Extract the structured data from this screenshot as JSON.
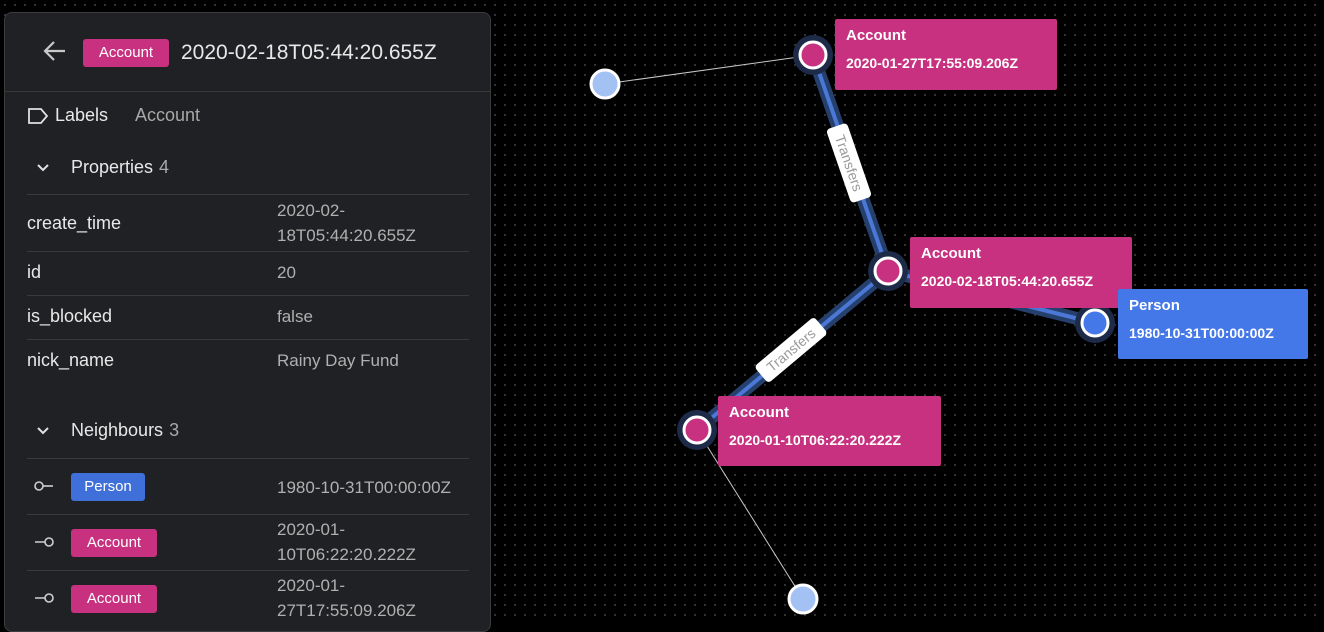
{
  "panel": {
    "header": {
      "chip": "Account",
      "title": "2020-02-18T05:44:20.655Z"
    },
    "labels": {
      "key": "Labels",
      "value": "Account"
    },
    "properties": {
      "title": "Properties",
      "count": "4",
      "rows": [
        {
          "key": "create_time",
          "value": "2020-02-18T05:44:20.655Z"
        },
        {
          "key": "id",
          "value": "20"
        },
        {
          "key": "is_blocked",
          "value": "false"
        },
        {
          "key": "nick_name",
          "value": "Rainy Day Fund"
        }
      ]
    },
    "neighbours": {
      "title": "Neighbours",
      "count": "3",
      "rows": [
        {
          "label": "Person",
          "value": "1980-10-31T00:00:00Z"
        },
        {
          "label": "Account",
          "value": "2020-01-10T06:22:20.222Z"
        },
        {
          "label": "Account",
          "value": "2020-01-27T17:55:09.206Z"
        }
      ]
    }
  },
  "graph": {
    "nodes": {
      "account_top": {
        "label": "Account",
        "value": "2020-01-27T17:55:09.206Z"
      },
      "account_mid": {
        "label": "Account",
        "value": "2020-02-18T05:44:20.655Z"
      },
      "person": {
        "label": "Person",
        "value": "1980-10-31T00:00:00Z"
      },
      "account_bottom": {
        "label": "Account",
        "value": "2020-01-10T06:22:20.222Z"
      }
    },
    "edges": {
      "transfers_upper": "Transfers",
      "transfers_lower": "Transfers"
    }
  },
  "colors": {
    "account": "#c8317f",
    "person": "#4477e8",
    "unlabeled_node": "#a4c1f4",
    "edge_highlight": "#4b78d6",
    "panel_bg": "#202124"
  },
  "icons": {
    "back": "arrow-left-icon",
    "labels": "tag-icon",
    "section_toggle": "chevron-down-icon",
    "incoming": "edge-incoming-icon",
    "outgoing": "edge-outgoing-icon"
  }
}
